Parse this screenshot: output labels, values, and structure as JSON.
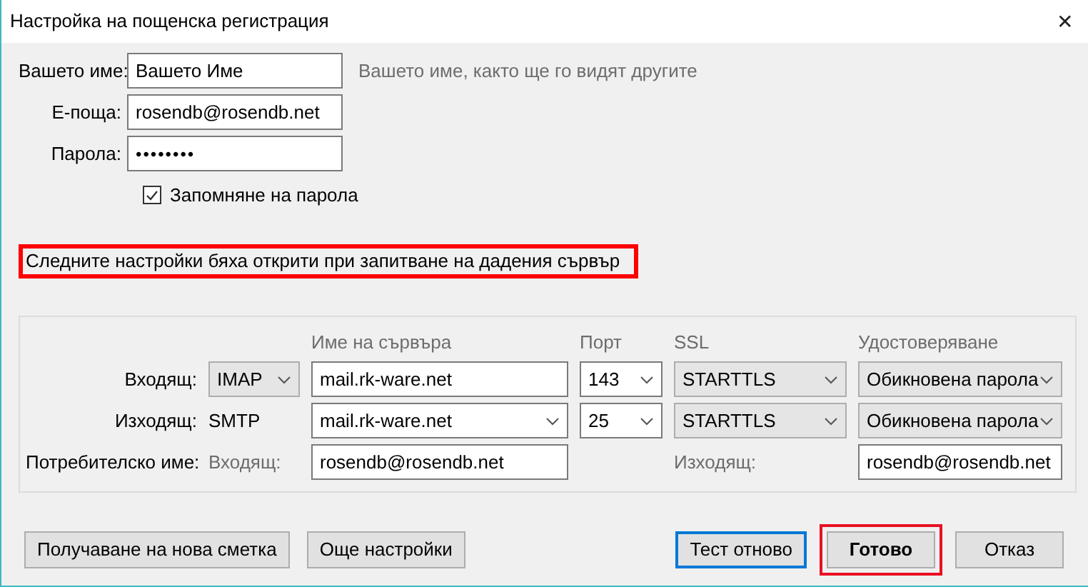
{
  "window": {
    "title": "Настройка на пощенска регистрация",
    "close": "✕"
  },
  "identity": [
    {
      "label": "Вашето име:",
      "value": "Вашето Име",
      "kind": "text",
      "hint": "Вашето име, както ще го видят другите"
    },
    {
      "label": "Е-поща:",
      "value": "rosendb@rosendb.net",
      "kind": "text"
    },
    {
      "label": "Парола:",
      "value": "••••••••",
      "kind": "password"
    }
  ],
  "remember_password": {
    "label": "Запомняне на парола",
    "checked": true
  },
  "notice": "Следните настройки бяха открити при запитване на дадения сървър",
  "server": {
    "headers": [
      "Име на сървъра",
      "Порт",
      "SSL",
      "Удостоверяване"
    ],
    "rows": [
      {
        "label": "Входящ:",
        "protocol": {
          "value": "IMAP",
          "kind": "dropdown"
        },
        "hostname": {
          "value": "mail.rk-ware.net",
          "kind": "text"
        },
        "port": "143",
        "ssl": "STARTTLS",
        "auth": "Обикновена парола"
      },
      {
        "label": "Изходящ:",
        "protocol": {
          "value": "SMTP",
          "kind": "label"
        },
        "hostname": {
          "value": "mail.rk-ware.net",
          "kind": "combo"
        },
        "port": "25",
        "ssl": "STARTTLS",
        "auth": "Обикновена парола"
      }
    ],
    "username": {
      "label": "Потребителско име:",
      "incoming_label": "Входящ:",
      "incoming": "rosendb@rosendb.net",
      "outgoing_label": "Изходящ:",
      "outgoing": "rosendb@rosendb.net"
    }
  },
  "buttons": [
    {
      "label": "Получаване на нова сметка",
      "kind": "plain"
    },
    {
      "label": "Още настройки",
      "kind": "plain"
    },
    {
      "label": "Тест отново",
      "kind": "focused"
    },
    {
      "label": "Готово",
      "kind": "default"
    },
    {
      "label": "Отказ",
      "kind": "plain"
    }
  ]
}
